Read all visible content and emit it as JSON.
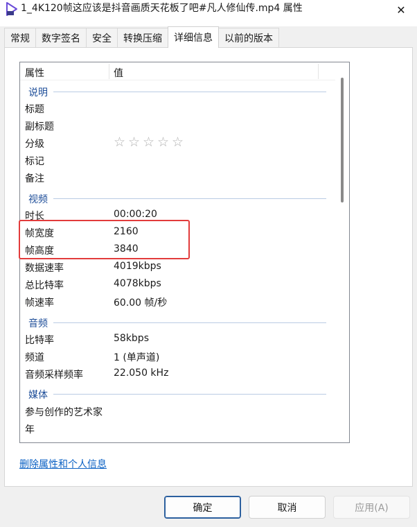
{
  "window": {
    "title": "1_4K120帧这应该是抖音画质天花板了吧#凡人修仙传.mp4 属性",
    "close_glyph": "✕"
  },
  "tabs": [
    {
      "label": "常规"
    },
    {
      "label": "数字签名"
    },
    {
      "label": "安全"
    },
    {
      "label": "转换压缩"
    },
    {
      "label": "详细信息"
    },
    {
      "label": "以前的版本"
    }
  ],
  "list": {
    "header": {
      "property": "属性",
      "value": "值"
    },
    "groups": {
      "description": "说明",
      "video": "视频",
      "audio": "音频",
      "media": "媒体"
    },
    "rows": {
      "title": {
        "key": "标题",
        "value": ""
      },
      "subtitle": {
        "key": "副标题",
        "value": ""
      },
      "rating": {
        "key": "分级",
        "stars": 5
      },
      "tags": {
        "key": "标记",
        "value": ""
      },
      "comments": {
        "key": "备注",
        "value": ""
      },
      "duration": {
        "key": "时长",
        "value": "00:00:20"
      },
      "frame_width": {
        "key": "帧宽度",
        "value": "2160"
      },
      "frame_height": {
        "key": "帧高度",
        "value": "3840"
      },
      "data_rate": {
        "key": "数据速率",
        "value": "4019kbps"
      },
      "total_bitrate": {
        "key": "总比特率",
        "value": "4078kbps"
      },
      "frame_rate": {
        "key": "帧速率",
        "value": "60.00 帧/秒"
      },
      "audio_bitrate": {
        "key": "比特率",
        "value": "58kbps"
      },
      "channels": {
        "key": "频道",
        "value": "1 (单声道)"
      },
      "sample_rate": {
        "key": "音频采样频率",
        "value": "22.050 kHz"
      },
      "contributing_artists": {
        "key": "参与创作的艺术家",
        "value": ""
      },
      "year": {
        "key": "年",
        "value": ""
      }
    }
  },
  "link": {
    "remove_properties": "删除属性和个人信息"
  },
  "buttons": {
    "ok": "确定",
    "cancel": "取消",
    "apply": "应用(A)"
  },
  "colors": {
    "highlight": "#e23b3b",
    "link": "#0b61c4",
    "group_label": "#1e4e99"
  },
  "icons": {
    "title": "video-file-icon",
    "rating": "star-outline-icon"
  }
}
